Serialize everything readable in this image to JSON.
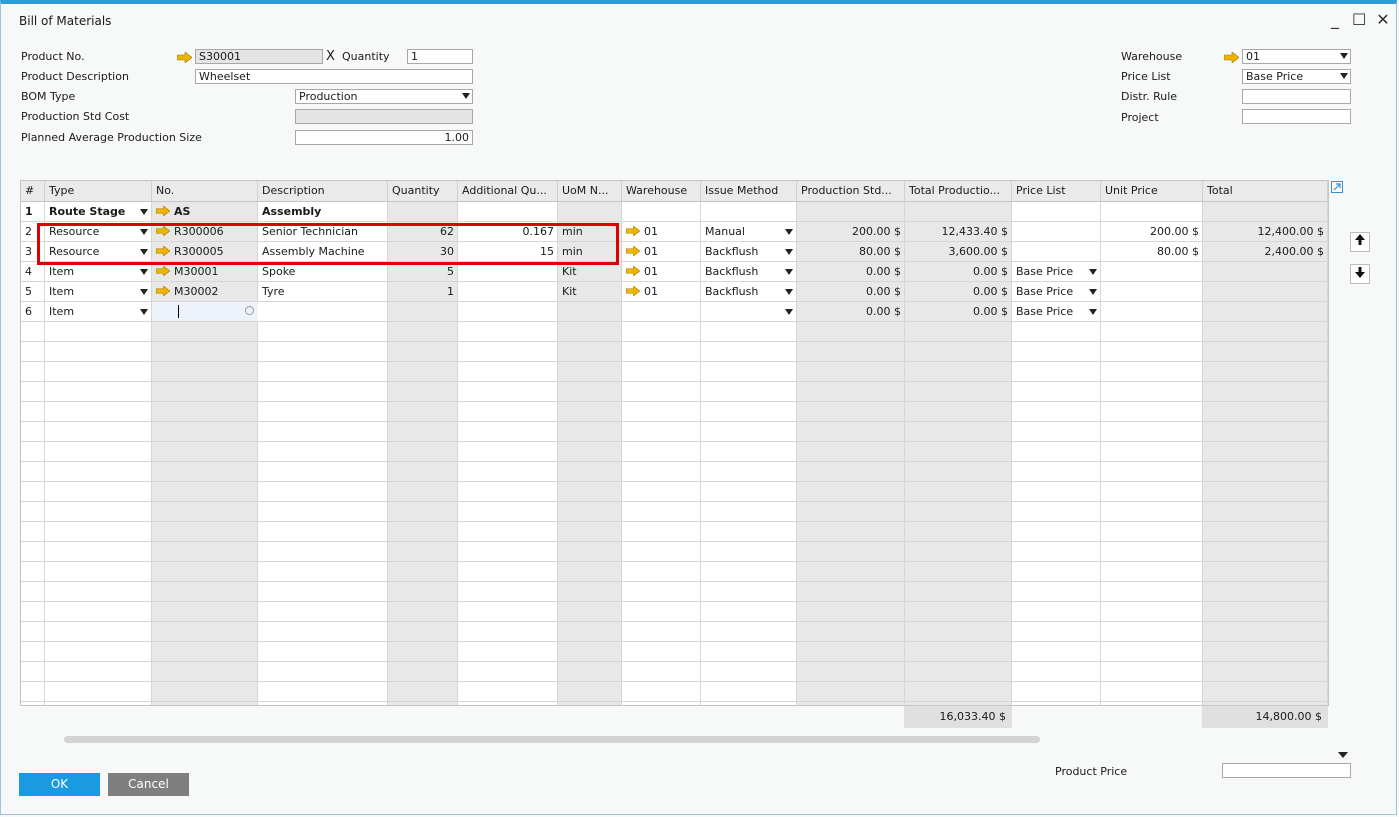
{
  "window": {
    "title": "Bill of Materials",
    "controls": [
      "_",
      "☐",
      "✕"
    ]
  },
  "header": {
    "product_no_label": "Product No.",
    "product_no_value": "S30001",
    "x_label": "X",
    "quantity_label": "Quantity",
    "quantity_value": "1",
    "product_desc_label": "Product Description",
    "product_desc_value": "Wheelset",
    "bom_type_label": "BOM Type",
    "bom_type_value": "Production",
    "prod_std_cost_label": "Production Std Cost",
    "prod_std_cost_value": "",
    "planned_avg_label": "Planned Average Production Size",
    "planned_avg_value": "1.00",
    "warehouse_label": "Warehouse",
    "warehouse_value": "01",
    "price_list_label": "Price List",
    "price_list_value": "Base Price",
    "distr_rule_label": "Distr. Rule",
    "distr_rule_value": "",
    "project_label": "Project",
    "project_value": ""
  },
  "grid": {
    "columns": [
      "#",
      "Type",
      "No.",
      "Description",
      "Quantity",
      "Additional Qu...",
      "UoM N...",
      "Warehouse",
      "Issue Method",
      "Production Std...",
      "Total Productio...",
      "Price List",
      "Unit Price",
      "Total"
    ],
    "rows": [
      {
        "n": "1",
        "type": "Route Stage",
        "no": "AS",
        "desc": "Assembly",
        "qty": "",
        "addqty": "",
        "uom": "",
        "wh": "",
        "issue": "",
        "pstd": "",
        "tprod": "",
        "plist": "",
        "uprice": "",
        "total": "",
        "bold": true
      },
      {
        "n": "2",
        "type": "Resource",
        "no": "R300006",
        "desc": "Senior Technician",
        "qty": "62",
        "addqty": "0.167",
        "uom": "min",
        "wh": "01",
        "issue": "Manual",
        "pstd": "200.00 $",
        "tprod": "12,433.40 $",
        "plist": "",
        "uprice": "200.00 $",
        "total": "12,400.00 $"
      },
      {
        "n": "3",
        "type": "Resource",
        "no": "R300005",
        "desc": "Assembly Machine",
        "qty": "30",
        "addqty": "15",
        "uom": "min",
        "wh": "01",
        "issue": "Backflush",
        "pstd": "80.00 $",
        "tprod": "3,600.00 $",
        "plist": "",
        "uprice": "80.00 $",
        "total": "2,400.00 $"
      },
      {
        "n": "4",
        "type": "Item",
        "no": "M30001",
        "desc": "Spoke",
        "qty": "5",
        "addqty": "",
        "uom": "Kit",
        "wh": "01",
        "issue": "Backflush",
        "pstd": "0.00 $",
        "tprod": "0.00 $",
        "plist": "Base Price",
        "uprice": "",
        "total": ""
      },
      {
        "n": "5",
        "type": "Item",
        "no": "M30002",
        "desc": "Tyre",
        "qty": "1",
        "addqty": "",
        "uom": "Kit",
        "wh": "01",
        "issue": "Backflush",
        "pstd": "0.00 $",
        "tprod": "0.00 $",
        "plist": "Base Price",
        "uprice": "",
        "total": ""
      },
      {
        "n": "6",
        "type": "Item",
        "no": "",
        "desc": "",
        "qty": "",
        "addqty": "",
        "uom": "",
        "wh": "",
        "issue": "",
        "pstd": "0.00 $",
        "tprod": "0.00 $",
        "plist": "Base Price",
        "uprice": "",
        "total": ""
      }
    ],
    "total_production": "16,033.40 $",
    "total": "14,800.00 $"
  },
  "footer": {
    "ok_label": "OK",
    "cancel_label": "Cancel",
    "product_price_label": "Product Price",
    "product_price_value": ""
  },
  "colors": {
    "accent": "#1a9ae0",
    "highlight": "#e00000",
    "link_arrow": "#f0b400"
  }
}
